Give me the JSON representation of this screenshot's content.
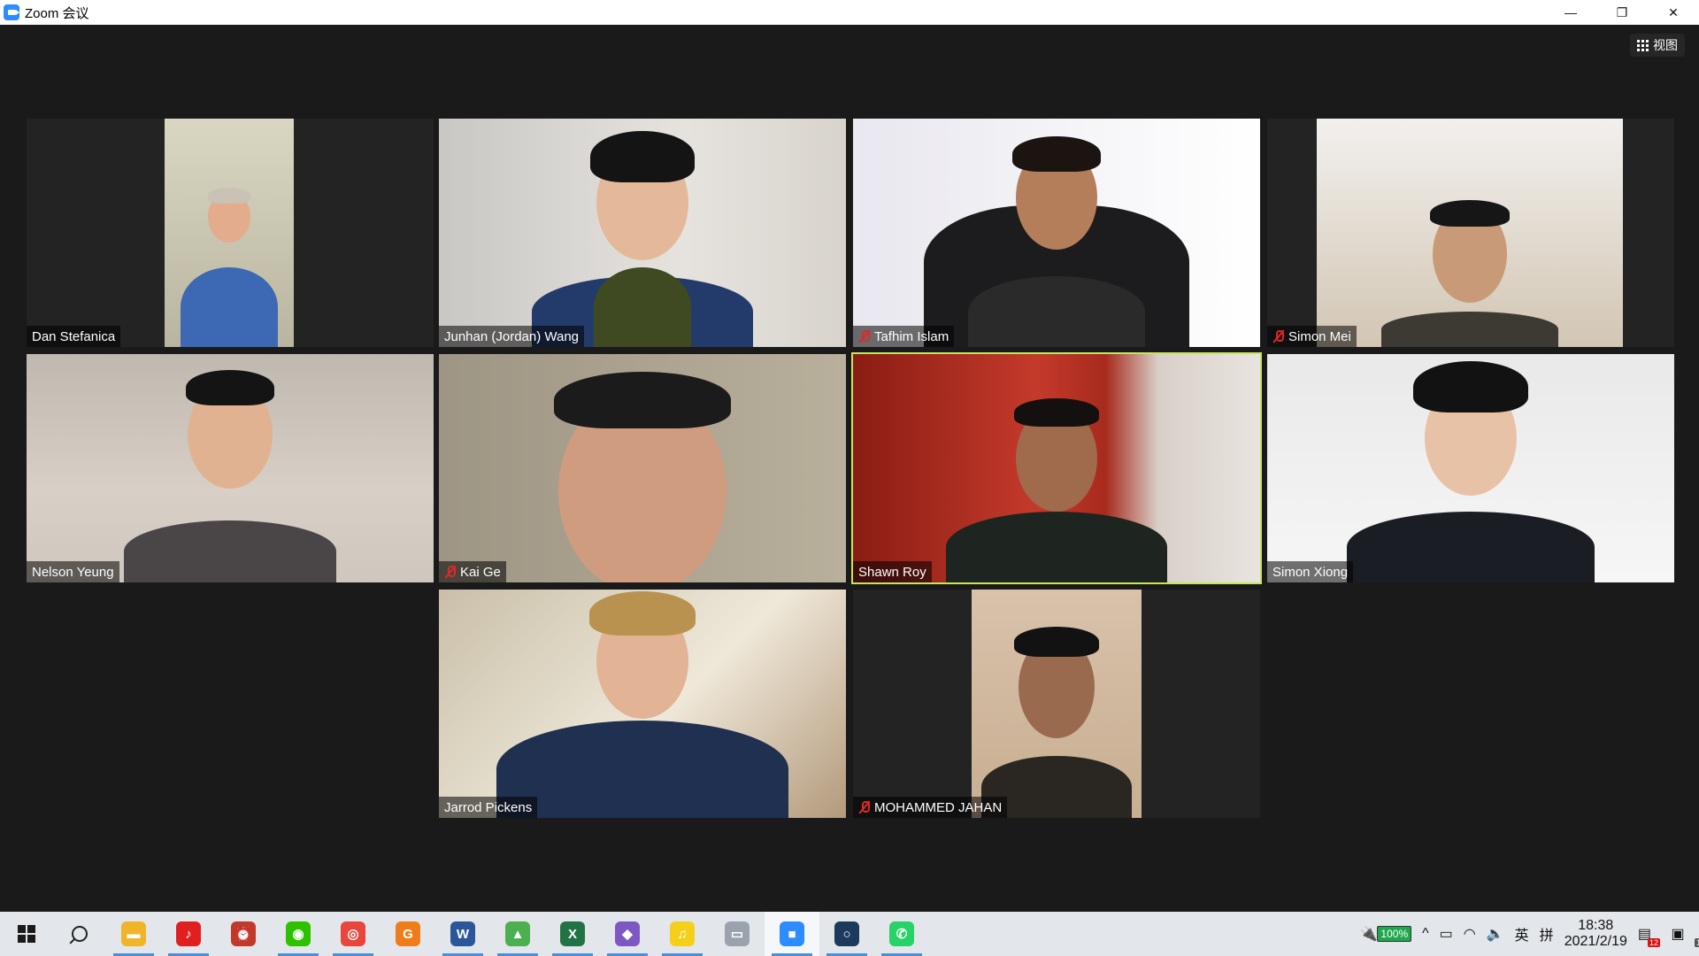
{
  "window": {
    "title": "Zoom 会议",
    "minimize_glyph": "—",
    "restore_glyph": "❐",
    "close_glyph": "✕"
  },
  "view_button": {
    "label": "视图",
    "icon": "grid-icon"
  },
  "participants": [
    {
      "name": "Dan Stefanica",
      "muted": false,
      "active_speaker": false
    },
    {
      "name": "Junhan (Jordan) Wang",
      "muted": false,
      "active_speaker": false
    },
    {
      "name": "Tafhim Islam",
      "muted": true,
      "active_speaker": false
    },
    {
      "name": "Simon Mei",
      "muted": true,
      "active_speaker": false
    },
    {
      "name": "Nelson Yeung",
      "muted": false,
      "active_speaker": false
    },
    {
      "name": "Kai Ge",
      "muted": true,
      "active_speaker": false
    },
    {
      "name": "Shawn Roy",
      "muted": false,
      "active_speaker": true
    },
    {
      "name": "Simon Xiong",
      "muted": false,
      "active_speaker": false
    },
    {
      "name": "Jarrod Pickens",
      "muted": false,
      "active_speaker": false
    },
    {
      "name": "MOHAMMED JAHAN",
      "muted": true,
      "active_speaker": false
    }
  ],
  "taskbar": {
    "apps": [
      {
        "name": "file-explorer",
        "glyph": "▬",
        "color": "#f0b429",
        "running": true
      },
      {
        "name": "netease-music",
        "glyph": "♪",
        "color": "#e02020",
        "running": true
      },
      {
        "name": "alarm-clock",
        "glyph": "⏰",
        "color": "#c0392b",
        "running": false
      },
      {
        "name": "wechat",
        "glyph": "◉",
        "color": "#2dc100",
        "running": true
      },
      {
        "name": "chrome",
        "glyph": "◎",
        "color": "#e8453c",
        "running": true
      },
      {
        "name": "pdf-reader",
        "glyph": "G",
        "color": "#f07c1c",
        "running": false
      },
      {
        "name": "word",
        "glyph": "W",
        "color": "#2b579a",
        "running": true
      },
      {
        "name": "image-viewer",
        "glyph": "▲",
        "color": "#4caf50",
        "running": true
      },
      {
        "name": "excel",
        "glyph": "X",
        "color": "#217346",
        "running": true
      },
      {
        "name": "visual-studio",
        "glyph": "◆",
        "color": "#7e57c2",
        "running": true
      },
      {
        "name": "qq-music",
        "glyph": "♫",
        "color": "#f5d01a",
        "running": true
      },
      {
        "name": "photos",
        "glyph": "▭",
        "color": "#9aa3ad",
        "running": false
      },
      {
        "name": "zoom",
        "glyph": "■",
        "color": "#2d8cff",
        "running": true,
        "focused": true
      },
      {
        "name": "cortana",
        "glyph": "○",
        "color": "#1b3a5c",
        "running": true
      },
      {
        "name": "whatsapp",
        "glyph": "✆",
        "color": "#25d366",
        "running": true
      }
    ],
    "tray": {
      "battery_percent": "100%",
      "chevron": "^",
      "ime_lang": "英",
      "ime_mode": "拼",
      "time": "18:38",
      "date": "2021/2/19",
      "notification_count": "12",
      "action_center_count": "1"
    }
  }
}
